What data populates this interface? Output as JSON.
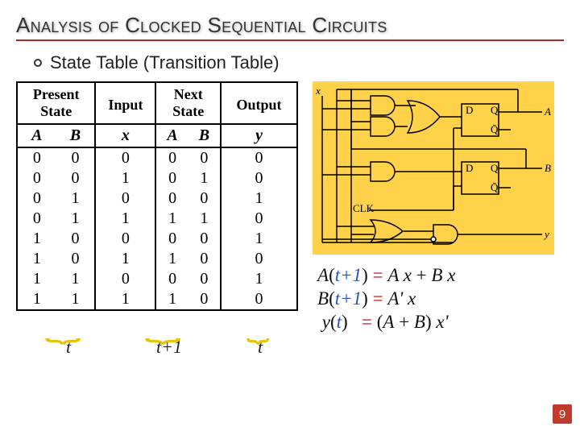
{
  "title": "Analysis of Clocked Sequential Circuits",
  "subtitle": "State Table (Transition Table)",
  "table": {
    "head": {
      "present1": "Present",
      "present2": "State",
      "input": "Input",
      "next1": "Next",
      "next2": "State",
      "output": "Output"
    },
    "cols": [
      "A",
      "B",
      "x",
      "A",
      "B",
      "y"
    ],
    "rows": [
      [
        "0",
        "0",
        "0",
        "0",
        "0",
        "0"
      ],
      [
        "0",
        "0",
        "1",
        "0",
        "1",
        "0"
      ],
      [
        "0",
        "1",
        "0",
        "0",
        "0",
        "1"
      ],
      [
        "0",
        "1",
        "1",
        "1",
        "1",
        "0"
      ],
      [
        "1",
        "0",
        "0",
        "0",
        "0",
        "1"
      ],
      [
        "1",
        "0",
        "1",
        "1",
        "0",
        "0"
      ],
      [
        "1",
        "1",
        "0",
        "0",
        "0",
        "1"
      ],
      [
        "1",
        "1",
        "1",
        "1",
        "0",
        "0"
      ]
    ]
  },
  "braces": [
    "t",
    "t+1",
    "t"
  ],
  "equations": {
    "t1": "t+1",
    "t": "t"
  },
  "circuit": {
    "x": "x",
    "D": "D",
    "Q": "Q",
    "Qbar": "Q̄",
    "A": "A",
    "B": "B",
    "CLK": "CLK",
    "y": "y"
  },
  "page": "9",
  "chart_data": {
    "type": "table",
    "title": "State / Transition Table",
    "columns": [
      "A(t)",
      "B(t)",
      "x",
      "A(t+1)",
      "B(t+1)",
      "y(t)"
    ],
    "rows": [
      [
        0,
        0,
        0,
        0,
        0,
        0
      ],
      [
        0,
        0,
        1,
        0,
        1,
        0
      ],
      [
        0,
        1,
        0,
        0,
        0,
        1
      ],
      [
        0,
        1,
        1,
        1,
        1,
        0
      ],
      [
        1,
        0,
        0,
        0,
        0,
        1
      ],
      [
        1,
        0,
        1,
        1,
        0,
        0
      ],
      [
        1,
        1,
        0,
        0,
        0,
        1
      ],
      [
        1,
        1,
        1,
        1,
        0,
        0
      ]
    ],
    "equations": [
      "A(t+1) = A x + B x",
      "B(t+1) = A' x",
      "y(t) = (A + B) x'"
    ]
  }
}
